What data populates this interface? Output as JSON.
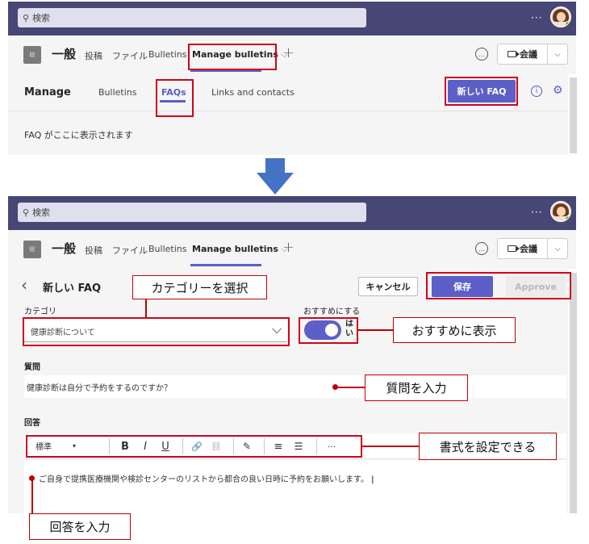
{
  "top": {
    "search_placeholder": "検索",
    "more": "···",
    "chan_avatar_text": "総",
    "channel_name": "一般",
    "tabs": [
      "投稿",
      "ファイル",
      "Bulletins",
      "Manage bulletins"
    ],
    "add_tab": "+",
    "meet_label": "会議",
    "manage_title": "Manage",
    "sub_tabs": [
      "Bulletins",
      "FAQs",
      "Links and contacts"
    ],
    "new_faq_button": "新しい FAQ",
    "empty_message": "FAQ がここに表示されます"
  },
  "bottom": {
    "back_icon": "‹",
    "form_title": "新しい FAQ",
    "cancel_button": "キャンセル",
    "save_button": "保存",
    "approve_button": "Approve",
    "category_label": "カテゴリ",
    "category_value": "健康診断について",
    "recommend_label": "おすすめにする",
    "recommend_toggle_text": "はい",
    "question_label": "質問",
    "question_value": "健康診断は自分で予約をするのですか？",
    "answer_label": "回答",
    "style_select": "標準",
    "toolbar": [
      "B",
      "I",
      "U",
      "🔗",
      "⛓",
      "✎",
      "≡",
      "☰",
      "···"
    ],
    "answer_value": "ご自身で提携医療機関や検診センターのリストから都合の良い日時に予約をお願いします。"
  },
  "callouts": {
    "category": "カテゴリーを選択",
    "recommend": "おすすめに表示",
    "question": "質問を入力",
    "format": "書式を設定できる",
    "answer": "回答を入力"
  },
  "colors": {
    "topbar": "#464775",
    "accent": "#5b5fc7",
    "callout_border": "#c00000",
    "arrow": "#4472c4"
  }
}
